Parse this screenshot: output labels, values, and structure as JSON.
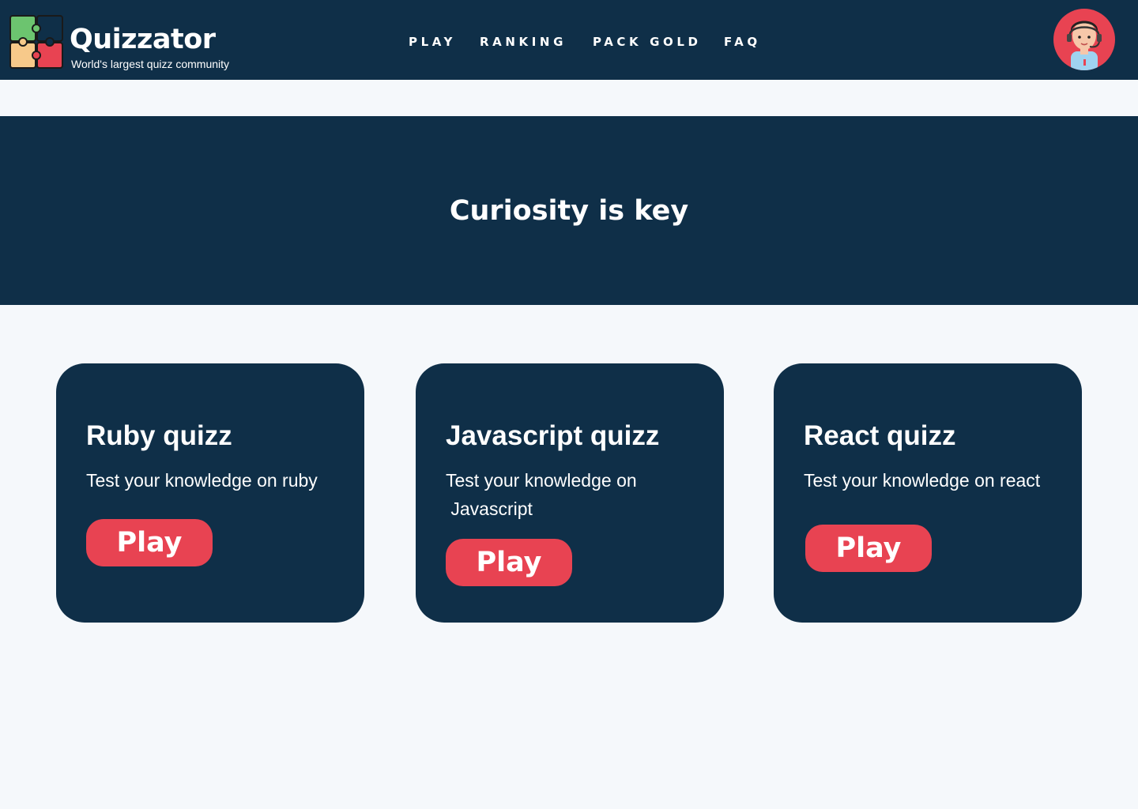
{
  "header": {
    "brand_name": "Quizzator",
    "tagline": "World's largest quizz community",
    "logo_icon": "puzzle-pieces-icon",
    "avatar_icon": "support-agent-avatar-icon",
    "nav": [
      {
        "label": "PLAY"
      },
      {
        "label": "RANKING"
      },
      {
        "label": "PACK GOLD"
      },
      {
        "label": "FAQ"
      }
    ]
  },
  "hero": {
    "title": "Curiosity is key"
  },
  "cards": [
    {
      "title": "Ruby quizz",
      "description": "Test your knowledge on ruby",
      "button": "Play"
    },
    {
      "title": "Javascript quizz",
      "description": "Test your knowledge on  Javascript",
      "button": "Play"
    },
    {
      "title": "React quizz",
      "description": "Test your knowledge on react",
      "button": "Play"
    }
  ],
  "colors": {
    "navy": "#0f2f48",
    "accent_red": "#e84352",
    "background": "#f5f8fb"
  }
}
